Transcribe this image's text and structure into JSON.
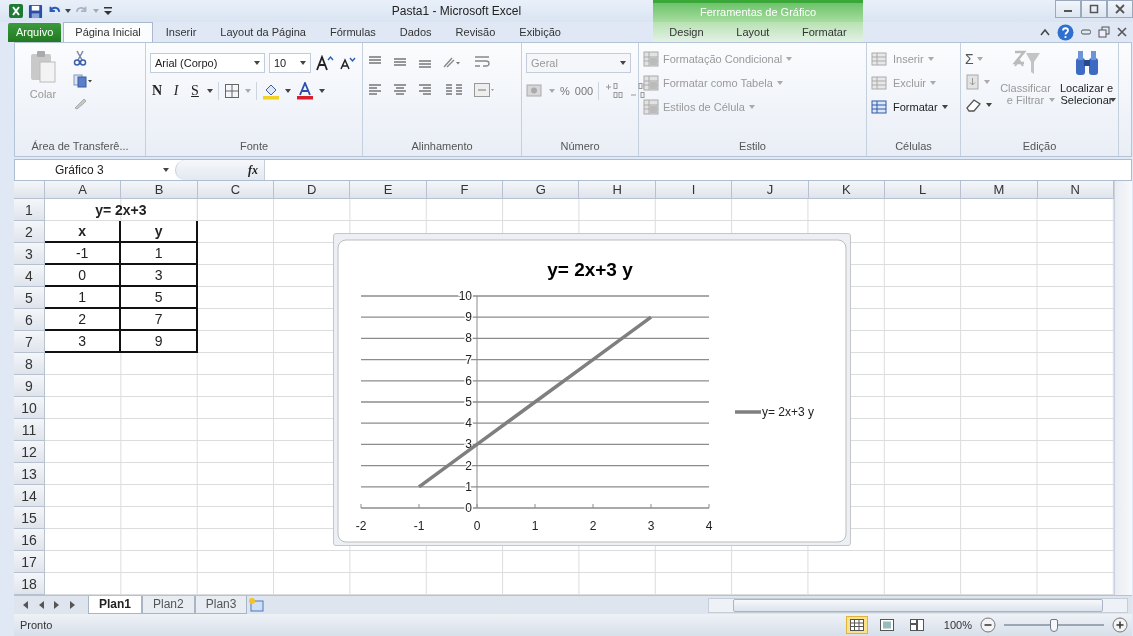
{
  "window": {
    "title": "Pasta1 - Microsoft Excel",
    "context_tab_group": "Ferramentas de Gráfico"
  },
  "tabs": [
    {
      "label": "Arquivo",
      "kind": "file",
      "selected": false
    },
    {
      "label": "Página Inicial",
      "kind": "normal",
      "selected": true
    },
    {
      "label": "Inserir",
      "kind": "normal",
      "selected": false
    },
    {
      "label": "Layout da Página",
      "kind": "normal",
      "selected": false
    },
    {
      "label": "Fórmulas",
      "kind": "normal",
      "selected": false
    },
    {
      "label": "Dados",
      "kind": "normal",
      "selected": false
    },
    {
      "label": "Revisão",
      "kind": "normal",
      "selected": false
    },
    {
      "label": "Exibição",
      "kind": "normal",
      "selected": false
    },
    {
      "label": "Design",
      "kind": "context",
      "selected": false
    },
    {
      "label": "Layout",
      "kind": "context",
      "selected": false
    },
    {
      "label": "Formatar",
      "kind": "context",
      "selected": false
    }
  ],
  "ribbon": [
    {
      "kind": "clipboard",
      "label": "Área de Transferê...",
      "paste": {
        "label": "Colar",
        "disabled": true
      }
    },
    {
      "kind": "font",
      "label": "Fonte",
      "font_name": "Arial (Corpo)",
      "font_size": "10",
      "bold": "N",
      "italic": "I",
      "underline": "S"
    },
    {
      "kind": "alignment",
      "label": "Alinhamento"
    },
    {
      "kind": "number",
      "label": "Número",
      "format": {
        "value": "Geral",
        "disabled": true
      },
      "percent": "%",
      "thousands": "000"
    },
    {
      "kind": "styles",
      "label": "Estilo",
      "items": [
        {
          "label": "Formatação Condicional",
          "disabled": true
        },
        {
          "label": "Formatar como Tabela",
          "disabled": true
        },
        {
          "label": "Estilos de Célula",
          "disabled": true
        }
      ]
    },
    {
      "kind": "cells",
      "label": "Células",
      "items": [
        {
          "label": "Inserir",
          "disabled": true
        },
        {
          "label": "Excluir",
          "disabled": true
        },
        {
          "label": "Formatar",
          "disabled": false
        }
      ]
    },
    {
      "kind": "editing",
      "label": "Edição",
      "sum": "Σ",
      "items": [
        {
          "lines": [
            "Classificar",
            "e Filtrar"
          ],
          "disabled": true
        },
        {
          "lines": [
            "Localizar e",
            "Selecionar"
          ],
          "disabled": false
        }
      ]
    }
  ],
  "formula_bar": {
    "name_box": "Gráfico 3",
    "function_label": "fx"
  },
  "sheet": {
    "columns": [
      "A",
      "B",
      "C",
      "D",
      "E",
      "F",
      "G",
      "H",
      "I",
      "J",
      "K",
      "L",
      "M",
      "N"
    ],
    "rows": [
      {
        "number": "1",
        "cells": [
          {
            "text": "y= 2x+3",
            "merged": true,
            "bold": true,
            "bordered": false
          }
        ]
      },
      {
        "number": "2",
        "cells": [
          {
            "text": "x",
            "merged": false,
            "bold": true,
            "bordered": true
          },
          {
            "text": "y",
            "merged": false,
            "bold": true,
            "bordered": true
          }
        ]
      },
      {
        "number": "3",
        "cells": [
          {
            "text": "-1",
            "merged": false,
            "bold": false,
            "bordered": true
          },
          {
            "text": "1",
            "merged": false,
            "bold": false,
            "bordered": true
          }
        ]
      },
      {
        "number": "4",
        "cells": [
          {
            "text": "0",
            "merged": false,
            "bold": false,
            "bordered": true
          },
          {
            "text": "3",
            "merged": false,
            "bold": false,
            "bordered": true
          }
        ]
      },
      {
        "number": "5",
        "cells": [
          {
            "text": "1",
            "merged": false,
            "bold": false,
            "bordered": true
          },
          {
            "text": "5",
            "merged": false,
            "bold": false,
            "bordered": true
          }
        ]
      },
      {
        "number": "6",
        "cells": [
          {
            "text": "2",
            "merged": false,
            "bold": false,
            "bordered": true
          },
          {
            "text": "7",
            "merged": false,
            "bold": false,
            "bordered": true
          }
        ]
      },
      {
        "number": "7",
        "cells": [
          {
            "text": "3",
            "merged": false,
            "bold": false,
            "bordered": true
          },
          {
            "text": "9",
            "merged": false,
            "bold": false,
            "bordered": true
          }
        ]
      },
      {
        "number": "8",
        "cells": []
      },
      {
        "number": "9",
        "cells": []
      },
      {
        "number": "10",
        "cells": []
      },
      {
        "number": "11",
        "cells": []
      },
      {
        "number": "12",
        "cells": []
      },
      {
        "number": "13",
        "cells": []
      },
      {
        "number": "14",
        "cells": []
      },
      {
        "number": "15",
        "cells": []
      },
      {
        "number": "16",
        "cells": []
      },
      {
        "number": "17",
        "cells": []
      },
      {
        "number": "18",
        "cells": []
      }
    ]
  },
  "chart": {
    "chart_data": {
      "type": "line",
      "title": "y= 2x+3 y",
      "grid": true,
      "x": [
        -1,
        0,
        1,
        2,
        3
      ],
      "series": [
        {
          "name": "y= 2x+3 y",
          "color": "#7f7f7f",
          "values": [
            1,
            3,
            5,
            7,
            9
          ]
        }
      ],
      "xlim": [
        -2,
        4
      ],
      "ylim": [
        0,
        10
      ],
      "xticks": [
        -2,
        -1,
        0,
        1,
        2,
        3,
        4
      ],
      "yticks": [
        0,
        1,
        2,
        3,
        4,
        5,
        6,
        7,
        8,
        9,
        10
      ]
    }
  },
  "sheet_tabs": [
    {
      "label": "Plan1",
      "selected": true
    },
    {
      "label": "Plan2",
      "selected": false
    },
    {
      "label": "Plan3",
      "selected": false
    }
  ],
  "status": {
    "text": "Pronto",
    "views": [
      {
        "kind": "normal",
        "selected": true
      },
      {
        "kind": "layout",
        "selected": false
      },
      {
        "kind": "pagebreak",
        "selected": false
      }
    ],
    "zoom": "100%",
    "zoom_slider": {
      "level": 0.5
    }
  }
}
